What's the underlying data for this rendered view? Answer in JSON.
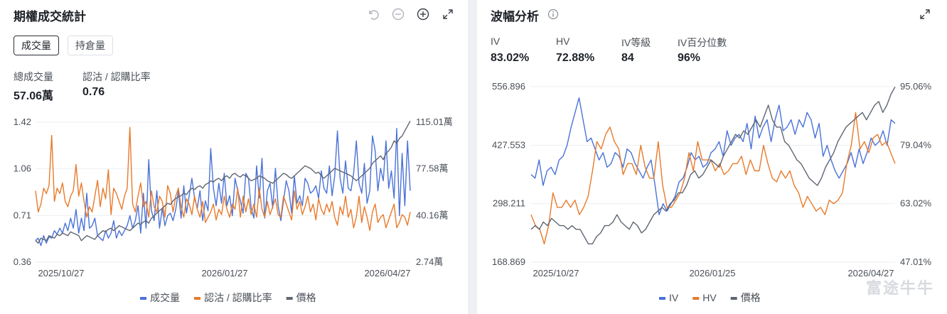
{
  "volume_panel": {
    "title": "期權成交統計",
    "tabs": [
      {
        "label": "成交量",
        "active": true
      },
      {
        "label": "持倉量",
        "active": false
      }
    ],
    "stats": [
      {
        "label": "總成交量",
        "value": "57.06萬"
      },
      {
        "label": "認沽 / 認購比率",
        "value": "0.76"
      }
    ],
    "icons": [
      "reset-icon",
      "zoom-out-icon",
      "zoom-in-icon",
      "expand-icon"
    ]
  },
  "iv_panel": {
    "title": "波幅分析",
    "stats": [
      {
        "label": "IV",
        "value": "83.02%"
      },
      {
        "label": "HV",
        "value": "72.88%"
      },
      {
        "label": "IV等級",
        "value": "84"
      },
      {
        "label": "IV百分位數",
        "value": "96%"
      }
    ],
    "icons": [
      "info-icon",
      "expand-icon"
    ]
  },
  "watermark": "富途牛牛",
  "chart_data": [
    {
      "type": "line",
      "x_ticks": [
        "2025/10/27",
        "2026/01/27",
        "2026/04/27"
      ],
      "left_axis_ticks": [
        "1.42",
        "1.06",
        "0.71",
        "0.36"
      ],
      "right_axis_ticks": [
        "115.01萬",
        "77.58萬",
        "40.16萬",
        "2.74萬"
      ],
      "left_ylim": [
        0.36,
        1.42
      ],
      "right_ylim": [
        2.74,
        115.01
      ],
      "right_unit": "萬",
      "grid": true,
      "legend_position": "bottom-center",
      "colors": {
        "volume": "#4a72d8",
        "put_call_ratio": "#e87a2b",
        "price": "#5f6672"
      },
      "series": [
        {
          "name": "成交量",
          "axis": "right",
          "color": "#4a72d8",
          "values": [
            20,
            22,
            16,
            24,
            18,
            23,
            22,
            28,
            25,
            30,
            26,
            34,
            28,
            38,
            30,
            45,
            26,
            38,
            28,
            58,
            30,
            32,
            38,
            24,
            22,
            20,
            28,
            22,
            26,
            36,
            22,
            28,
            24,
            28,
            32,
            40,
            30,
            36,
            48,
            26,
            58,
            30,
            85,
            44,
            36,
            60,
            30,
            46,
            32,
            40,
            42,
            36,
            45,
            60,
            38,
            64,
            42,
            56,
            70,
            54,
            46,
            60,
            36,
            52,
            44,
            94,
            62,
            48,
            66,
            50,
            74,
            48,
            56,
            40,
            70,
            60,
            52,
            42,
            74,
            70,
            46,
            38,
            80,
            54,
            86,
            38,
            60,
            66,
            46,
            78,
            48,
            36,
            52,
            68,
            60,
            42,
            72,
            50,
            56,
            48,
            70,
            66,
            58,
            60,
            64,
            54,
            76,
            62,
            58,
            80,
            56,
            72,
            108,
            70,
            58,
            84,
            62,
            60,
            74,
            100,
            66,
            58,
            82,
            50,
            60,
            104,
            92,
            60,
            78,
            68,
            100,
            62,
            76,
            54,
            110,
            40,
            90,
            48,
            100,
            60
          ]
        },
        {
          "name": "認沽 / 認購比率",
          "axis": "left",
          "color": "#e87a2b",
          "values": [
            0.9,
            0.74,
            0.8,
            0.92,
            0.88,
            0.94,
            1.32,
            0.82,
            0.92,
            0.88,
            0.96,
            0.82,
            0.78,
            0.86,
            0.9,
            1.1,
            0.86,
            0.96,
            0.82,
            0.7,
            0.78,
            0.74,
            0.86,
            0.98,
            0.78,
            0.92,
            0.84,
            1.06,
            0.72,
            0.92,
            0.88,
            0.82,
            0.76,
            0.86,
            0.92,
            1.38,
            0.8,
            0.74,
            0.86,
            0.96,
            0.78,
            0.82,
            0.7,
            0.9,
            0.78,
            0.74,
            0.86,
            0.82,
            0.7,
            0.94,
            0.88,
            0.74,
            0.86,
            0.92,
            0.78,
            0.7,
            0.84,
            0.8,
            0.72,
            0.86,
            0.76,
            0.7,
            0.82,
            0.66,
            0.7,
            0.74,
            0.8,
            0.68,
            0.76,
            0.72,
            0.86,
            0.76,
            0.7,
            0.8,
            0.76,
            0.92,
            0.7,
            0.86,
            0.74,
            0.84,
            0.72,
            0.8,
            0.7,
            0.92,
            0.76,
            0.7,
            0.82,
            0.72,
            0.78,
            0.84,
            0.72,
            0.7,
            0.86,
            0.8,
            0.74,
            0.68,
            0.9,
            0.76,
            0.82,
            0.72,
            0.78,
            0.86,
            0.74,
            0.8,
            0.68,
            0.84,
            0.76,
            0.72,
            0.8,
            0.74,
            0.82,
            0.7,
            0.64,
            0.78,
            0.72,
            0.86,
            0.7,
            0.76,
            0.62,
            0.7,
            0.86,
            0.66,
            0.78,
            0.7,
            0.6,
            0.74,
            0.8,
            0.66,
            0.7,
            0.72,
            0.62,
            0.68,
            0.74,
            0.8,
            0.62,
            0.66,
            0.72,
            0.7,
            0.64,
            0.74
          ]
        },
        {
          "name": "價格",
          "axis": "right",
          "color": "#5f6672",
          "values": [
            20,
            18,
            22,
            21,
            20,
            24,
            23,
            22,
            25,
            24,
            26,
            25,
            24,
            27,
            26,
            25,
            24,
            20,
            22,
            24,
            23,
            22,
            21,
            24,
            26,
            28,
            27,
            29,
            30,
            28,
            30,
            32,
            31,
            30,
            29,
            28,
            30,
            32,
            34,
            33,
            35,
            36,
            34,
            38,
            40,
            42,
            44,
            46,
            48,
            50,
            49,
            52,
            54,
            55,
            56,
            58,
            57,
            60,
            62,
            61,
            63,
            64,
            62,
            65,
            66,
            68,
            67,
            69,
            70,
            68,
            71,
            72,
            70,
            73,
            74,
            72,
            71,
            73,
            72,
            70,
            68,
            69,
            70,
            72,
            71,
            70,
            68,
            67,
            66,
            68,
            70,
            72,
            74,
            73,
            71,
            70,
            72,
            74,
            76,
            78,
            80,
            79,
            78,
            76,
            74,
            75,
            72,
            70,
            72,
            74,
            76,
            78,
            77,
            76,
            75,
            74,
            73,
            72,
            70,
            68,
            70,
            72,
            74,
            76,
            78,
            82,
            84,
            86,
            88,
            85,
            90,
            92,
            95,
            100,
            98,
            102,
            104,
            108,
            112,
            116
          ]
        }
      ]
    },
    {
      "type": "line",
      "x_ticks": [
        "2025/10/27",
        "2026/01/25",
        "2026/04/27"
      ],
      "left_axis_ticks": [
        "556.896",
        "427.553",
        "298.211",
        "168.869"
      ],
      "right_axis_ticks": [
        "95.06%",
        "79.04%",
        "63.02%",
        "47.01%"
      ],
      "left_ylim": [
        168.869,
        556.896
      ],
      "right_ylim": [
        47.01,
        95.06
      ],
      "right_unit": "%",
      "grid": true,
      "legend_position": "bottom-center",
      "colors": {
        "iv": "#4a72d8",
        "hv": "#e87a2b",
        "price": "#5f6672"
      },
      "series": [
        {
          "name": "IV",
          "axis": "right",
          "color": "#4a72d8",
          "values": [
            71,
            70,
            75,
            68,
            72,
            73,
            71,
            75,
            76,
            79,
            84,
            88,
            92,
            86,
            80,
            81,
            78,
            75,
            77,
            73,
            74,
            77,
            76,
            73,
            78,
            77,
            74,
            72,
            70,
            73,
            75,
            68,
            60,
            63,
            61,
            63,
            65,
            69,
            70,
            73,
            77,
            75,
            76,
            73,
            74,
            77,
            78,
            80,
            76,
            83,
            79,
            81,
            82,
            80,
            85,
            78,
            87,
            81,
            84,
            86,
            80,
            86,
            90,
            83,
            84,
            86,
            82,
            86,
            84,
            88,
            86,
            81,
            85,
            76,
            79,
            75,
            72,
            70,
            72,
            74,
            77,
            73,
            78,
            74,
            77,
            81,
            79,
            80,
            83,
            79,
            86,
            85
          ]
        },
        {
          "name": "HV",
          "axis": "right",
          "color": "#e87a2b",
          "values": [
            60,
            57,
            56,
            52,
            57,
            66,
            62,
            62,
            64,
            62,
            64,
            60,
            62,
            65,
            72,
            80,
            78,
            82,
            84,
            80,
            78,
            71,
            74,
            74,
            71,
            79,
            73,
            70,
            70,
            80,
            68,
            62,
            62,
            64,
            66,
            70,
            77,
            72,
            80,
            75,
            75,
            75,
            72,
            74,
            71,
            72,
            74,
            74,
            76,
            71,
            75,
            72,
            72,
            79,
            74,
            70,
            69,
            72,
            70,
            72,
            68,
            66,
            62,
            65,
            63,
            61,
            62,
            60,
            64,
            63,
            64,
            66,
            74,
            79,
            88,
            78,
            80,
            77,
            81,
            82,
            79,
            80,
            77,
            74
          ]
        },
        {
          "name": "價格",
          "axis": "right",
          "color": "#5f6672",
          "values": [
            56,
            57,
            56,
            58,
            57,
            59,
            58,
            57,
            57,
            56,
            57,
            56,
            56,
            54,
            52,
            52,
            54,
            55,
            57,
            57,
            58,
            60,
            58,
            57,
            56,
            58,
            57,
            55,
            56,
            58,
            60,
            61,
            62,
            61,
            63,
            64,
            66,
            66,
            68,
            71,
            72,
            70,
            71,
            73,
            75,
            74,
            73,
            76,
            78,
            80,
            82,
            81,
            83,
            82,
            84,
            86,
            84,
            87,
            90,
            86,
            84,
            84,
            80,
            79,
            77,
            75,
            74,
            72,
            70,
            69,
            68,
            70,
            73,
            75,
            77,
            80,
            82,
            84,
            85,
            86,
            87,
            88,
            86,
            88,
            90,
            91,
            88,
            90,
            93,
            95
          ]
        }
      ]
    }
  ]
}
